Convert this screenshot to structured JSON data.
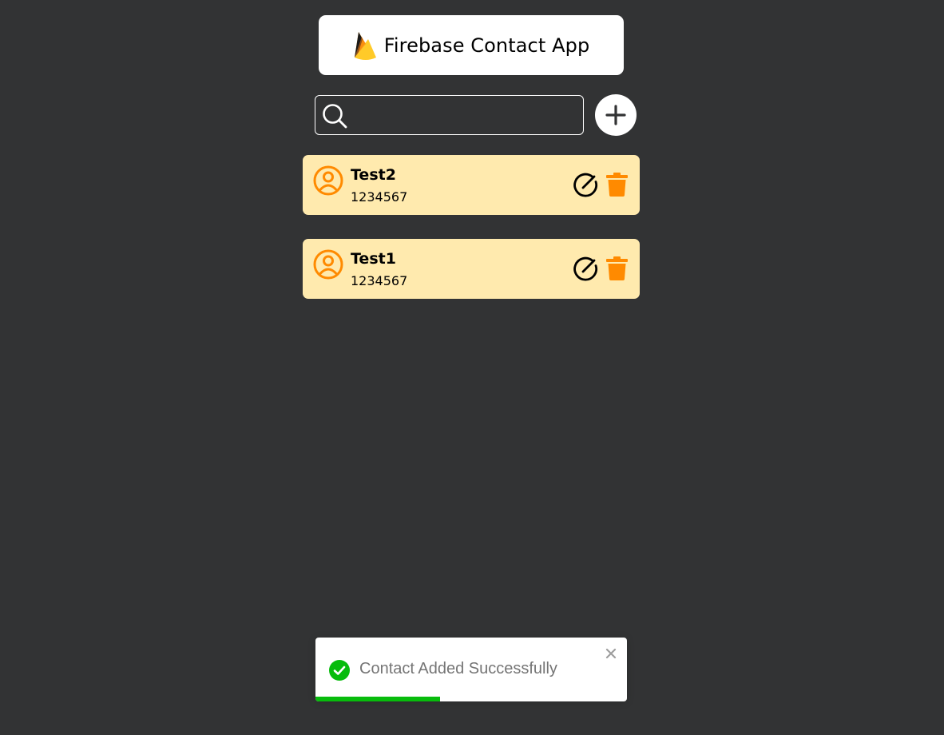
{
  "header": {
    "title": "Firebase Contact App",
    "logo_icon": "firebase-flame-icon"
  },
  "search": {
    "value": "",
    "placeholder": "",
    "icon": "search-icon"
  },
  "actions": {
    "add_icon": "plus-icon"
  },
  "contacts": [
    {
      "name": "Test2",
      "phone": "1234567"
    },
    {
      "name": "Test1",
      "phone": "1234567"
    }
  ],
  "toast": {
    "message": "Contact Added Successfully",
    "type": "success",
    "progress": 0.4
  },
  "colors": {
    "background": "#323334",
    "card": "#FFEAAE",
    "accent": "#FF8A00",
    "success": "#07BC0C"
  }
}
